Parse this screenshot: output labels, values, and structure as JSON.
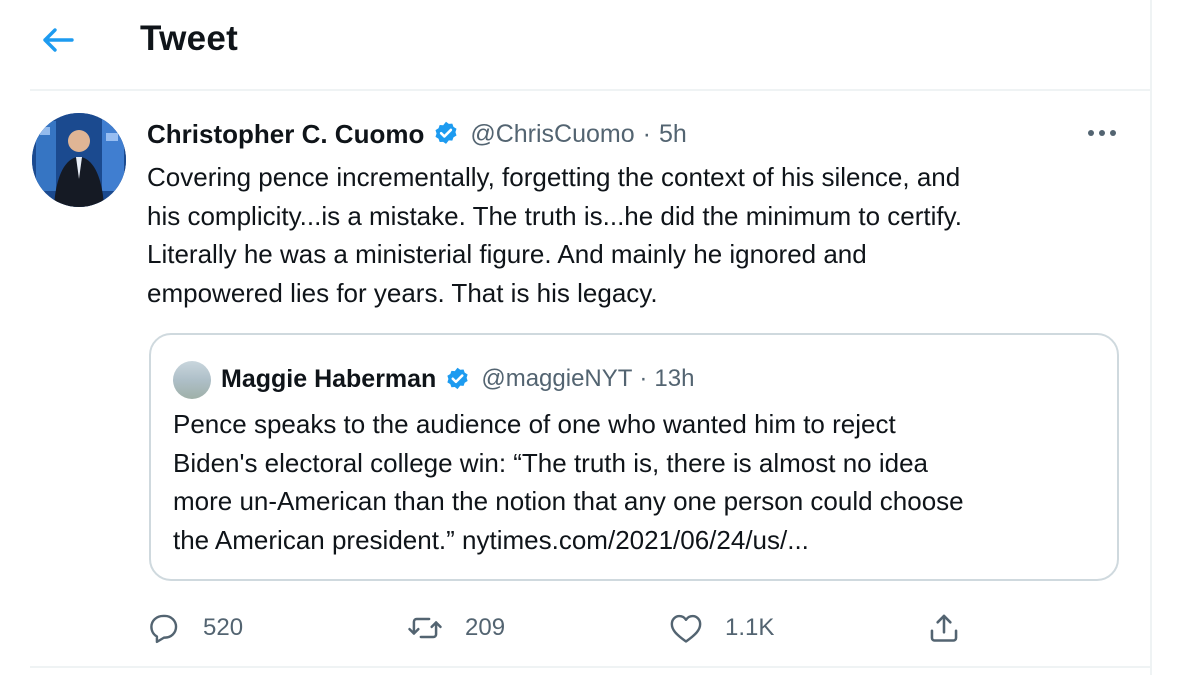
{
  "header": {
    "title": "Tweet",
    "back_icon": "arrow-left-icon"
  },
  "colors": {
    "accent": "#1d9bf0",
    "text_primary": "#0f1419",
    "text_secondary": "#536471",
    "border": "#cfd9de"
  },
  "tweet": {
    "author_name": "Christopher C. Cuomo",
    "verified": true,
    "handle": "@ChrisCuomo",
    "separator": "·",
    "time": "5h",
    "more_icon": "more-horizontal-icon",
    "text_lines": [
      "Covering pence incrementally, forgetting the context of his silence, and",
      "his complicity...is a mistake. The truth is...he did the minimum to certify.",
      "Literally he was a ministerial figure. And mainly he ignored and",
      "empowered lies for years. That is his legacy."
    ]
  },
  "quote_tweet": {
    "author_name": "Maggie Haberman",
    "verified": true,
    "handle": "@maggieNYT",
    "separator": "·",
    "time": "13h",
    "text_lines": [
      "Pence speaks to the audience of one who wanted him to reject",
      "Biden's electoral college win: “The truth is, there is almost no idea",
      "more un-American than the notion that any one person could choose"
    ],
    "last_line_text": "the American president.”",
    "link": "nytimes.com/2021/06/24/us/..."
  },
  "actions": {
    "reply": {
      "icon": "reply-icon",
      "count": "520"
    },
    "retweet": {
      "icon": "retweet-icon",
      "count": "209"
    },
    "like": {
      "icon": "heart-icon",
      "count": "1.1K"
    },
    "share": {
      "icon": "share-icon"
    }
  }
}
